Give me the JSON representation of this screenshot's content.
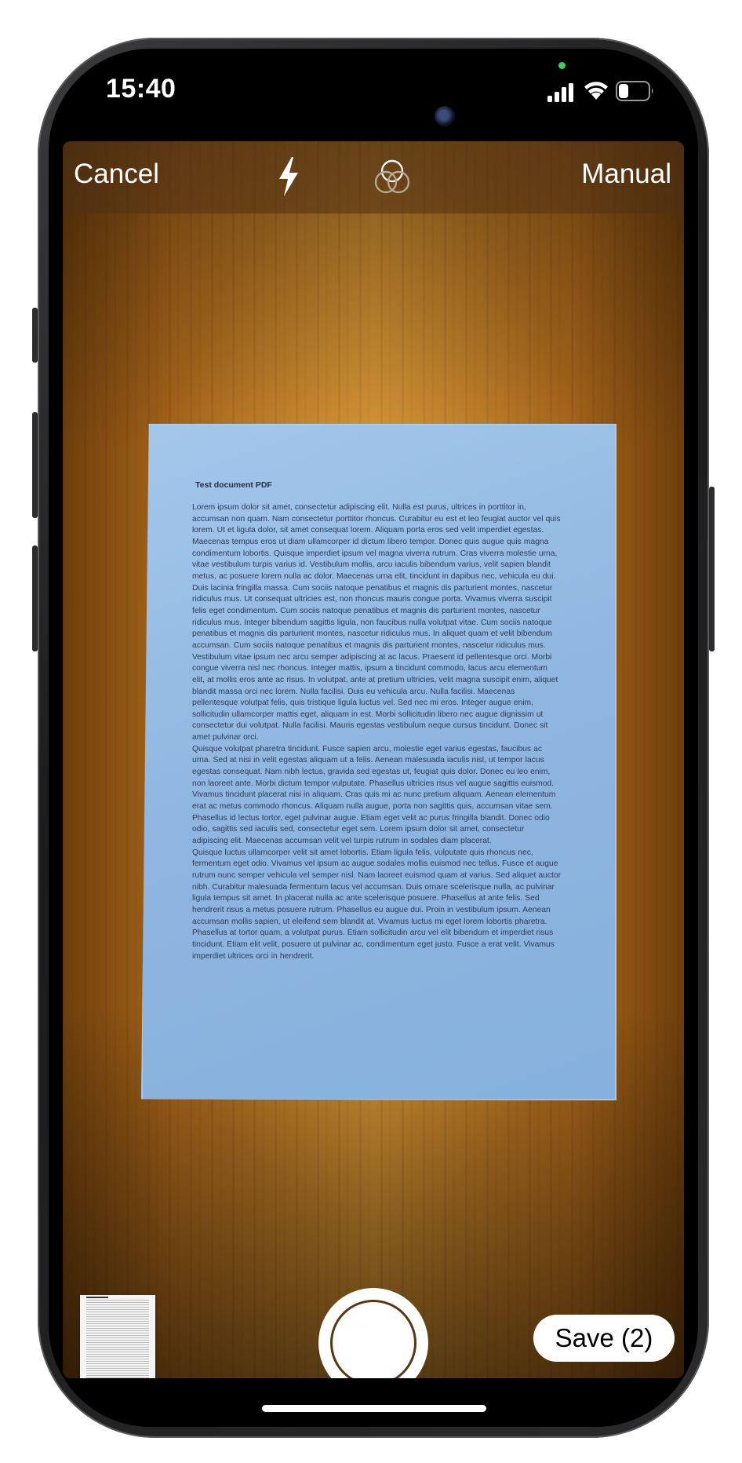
{
  "status_bar": {
    "time": "15:40"
  },
  "scanner": {
    "cancel_label": "Cancel",
    "manual_label": "Manual",
    "save_label": "Save (2)",
    "flash_icon": "flash-icon",
    "filter_icon": "color-filter-icon"
  },
  "document": {
    "title": "Test document PDF",
    "paragraphs": [
      "Lorem ipsum dolor sit amet, consectetur adipiscing elit. Nulla est purus, ultrices in porttitor in, accumsan non quam. Nam consectetur porttitor rhoncus. Curabitur eu est et leo feugiat auctor vel quis lorem. Ut et ligula dolor, sit amet consequat lorem. Aliquam porta eros sed velit imperdiet egestas. Maecenas tempus eros ut diam ullamcorper id dictum libero tempor. Donec quis augue quis magna condimentum lobortis. Quisque imperdiet ipsum vel magna viverra rutrum. Cras viverra molestie urna, vitae vestibulum turpis varius id. Vestibulum mollis, arcu iaculis bibendum varius, velit sapien blandit metus, ac posuere lorem nulla ac dolor. Maecenas urna elit, tincidunt in dapibus nec, vehicula eu dui. Duis lacinia fringilla massa. Cum sociis natoque penatibus et magnis dis parturient montes, nascetur ridiculus mus. Ut consequat ultricies est, non rhoncus mauris congue porta. Vivamus viverra suscipit felis eget condimentum. Cum sociis natoque penatibus et magnis dis parturient montes, nascetur ridiculus mus. Integer bibendum sagittis ligula, non faucibus nulla volutpat vitae. Cum sociis natoque penatibus et magnis dis parturient montes, nascetur ridiculus mus. In aliquet quam et velit bibendum accumsan. Cum sociis natoque penatibus et magnis dis parturient montes, nascetur ridiculus mus. Vestibulum vitae ipsum nec arcu semper adipiscing at ac lacus. Praesent id pellentesque orci. Morbi congue viverra nisl nec rhoncus. Integer mattis, ipsum a tincidunt commodo, lacus arcu elementum elit, at mollis eros ante ac risus. In volutpat, ante at pretium ultricies, velit magna suscipit enim, aliquet blandit massa orci nec lorem. Nulla facilisi. Duis eu vehicula arcu. Nulla facilisi. Maecenas pellentesque volutpat felis, quis tristique ligula luctus vel. Sed nec mi eros. Integer augue enim, sollicitudin ullamcorper mattis eget, aliquam in est. Morbi sollicitudin libero nec augue dignissim ut consectetur dui volutpat. Nulla facilisi. Mauris egestas vestibulum neque cursus tincidunt. Donec sit amet pulvinar orci.",
      "Quisque volutpat pharetra tincidunt. Fusce sapien arcu, molestie eget varius egestas, faucibus ac urna. Sed at nisi in velit egestas aliquam ut a felis. Aenean malesuada iaculis nisl, ut tempor lacus egestas consequat. Nam nibh lectus, gravida sed egestas ut, feugiat quis dolor. Donec eu leo enim, non laoreet ante. Morbi dictum tempor vulputate. Phasellus ultricies risus vel augue sagittis euismod. Vivamus tincidunt placerat nisi in aliquam. Cras quis mi ac nunc pretium aliquam. Aenean elementum erat ac metus commodo rhoncus. Aliquam nulla augue, porta non sagittis quis, accumsan vitae sem. Phasellus id lectus tortor, eget pulvinar augue. Etiam eget velit ac purus fringilla blandit. Donec odio odio, sagittis sed iaculis sed, consectetur eget sem. Lorem ipsum dolor sit amet, consectetur adipiscing elit. Maecenas accumsan velit vel turpis rutrum in sodales diam placerat.",
      "Quisque luctus ullamcorper velit sit amet lobortis. Etiam ligula felis, vulputate quis rhoncus nec, fermentum eget odio. Vivamus vel ipsum ac augue sodales mollis euismod nec tellus. Fusce et augue rutrum nunc semper vehicula vel semper nisl. Nam laoreet euismod quam at varius. Sed aliquet auctor nibh. Curabitur malesuada fermentum lacus vel accumsan. Duis ornare scelerisque nulla, ac pulvinar ligula tempus sit amet. In placerat nulla ac ante scelerisque posuere. Phasellus at ante felis. Sed hendrerit risus a metus posuere rutrum. Phasellus eu augue dui. Proin in vestibulum ipsum. Aenean accumsan mollis sapien, ut eleifend sem blandit at. Vivamus luctus mi eget lorem lobortis pharetra. Phasellus at tortor quam, a volutpat purus. Etiam sollicitudin arcu vel elit bibendum et imperdiet risus tincidunt. Etiam elit velit, posuere ut pulvinar ac, condimentum eget justo. Fusce a erat velit. Vivamus imperdiet ultrices orci in hendrerit."
    ]
  }
}
